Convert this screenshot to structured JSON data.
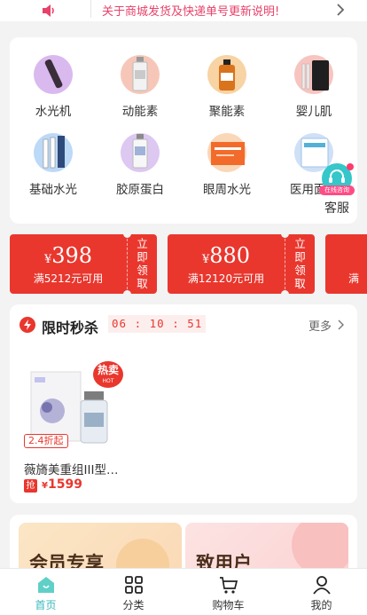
{
  "notice": {
    "text": "关于商城发货及快递单号更新说明!",
    "icon": "speaker-icon"
  },
  "categories": [
    {
      "label": "水光机",
      "color": "#d9b9ee"
    },
    {
      "label": "动能素",
      "color": "#f6c7b9"
    },
    {
      "label": "聚能素",
      "color": "#f8d3a3"
    },
    {
      "label": "婴儿肌",
      "color": "#f7c4c0"
    },
    {
      "label": "基础水光",
      "color": "#bcd9f7"
    },
    {
      "label": "胶原蛋白",
      "color": "#dcc8f1"
    },
    {
      "label": "眼周水光",
      "color": "#fad7b6"
    },
    {
      "label": "医用面膜",
      "color": "#cfe0f7"
    }
  ],
  "service": {
    "label": "客服",
    "tag": "在线咨询"
  },
  "coupons": [
    {
      "yen": "¥",
      "amount": "398",
      "condition": "满5212元可用",
      "claim": [
        "立",
        "即",
        "领",
        "取"
      ]
    },
    {
      "yen": "¥",
      "amount": "880",
      "condition": "满12120元可用",
      "claim": [
        "立",
        "即",
        "领",
        "取"
      ]
    },
    {
      "yen": "¥",
      "amount": "",
      "condition": "满",
      "claim": []
    }
  ],
  "flash_sale": {
    "title": "限时秒杀",
    "timer": "06 : 10 : 51",
    "more": "更多",
    "product": {
      "badge": "热卖",
      "badge_sub": "HOT",
      "discount": "2.4折起",
      "name": "薇旖美重组III型…",
      "tag": "抢",
      "yen": "¥",
      "price": "1599"
    }
  },
  "member": {
    "left_title": "会员专享",
    "right_title": "致用户"
  },
  "tabbar": {
    "items": [
      {
        "label": "首页",
        "icon": "home-icon",
        "active": true
      },
      {
        "label": "分类",
        "icon": "grid-icon",
        "active": false
      },
      {
        "label": "购物车",
        "icon": "cart-icon",
        "active": false
      },
      {
        "label": "我的",
        "icon": "user-icon",
        "active": false
      }
    ]
  }
}
